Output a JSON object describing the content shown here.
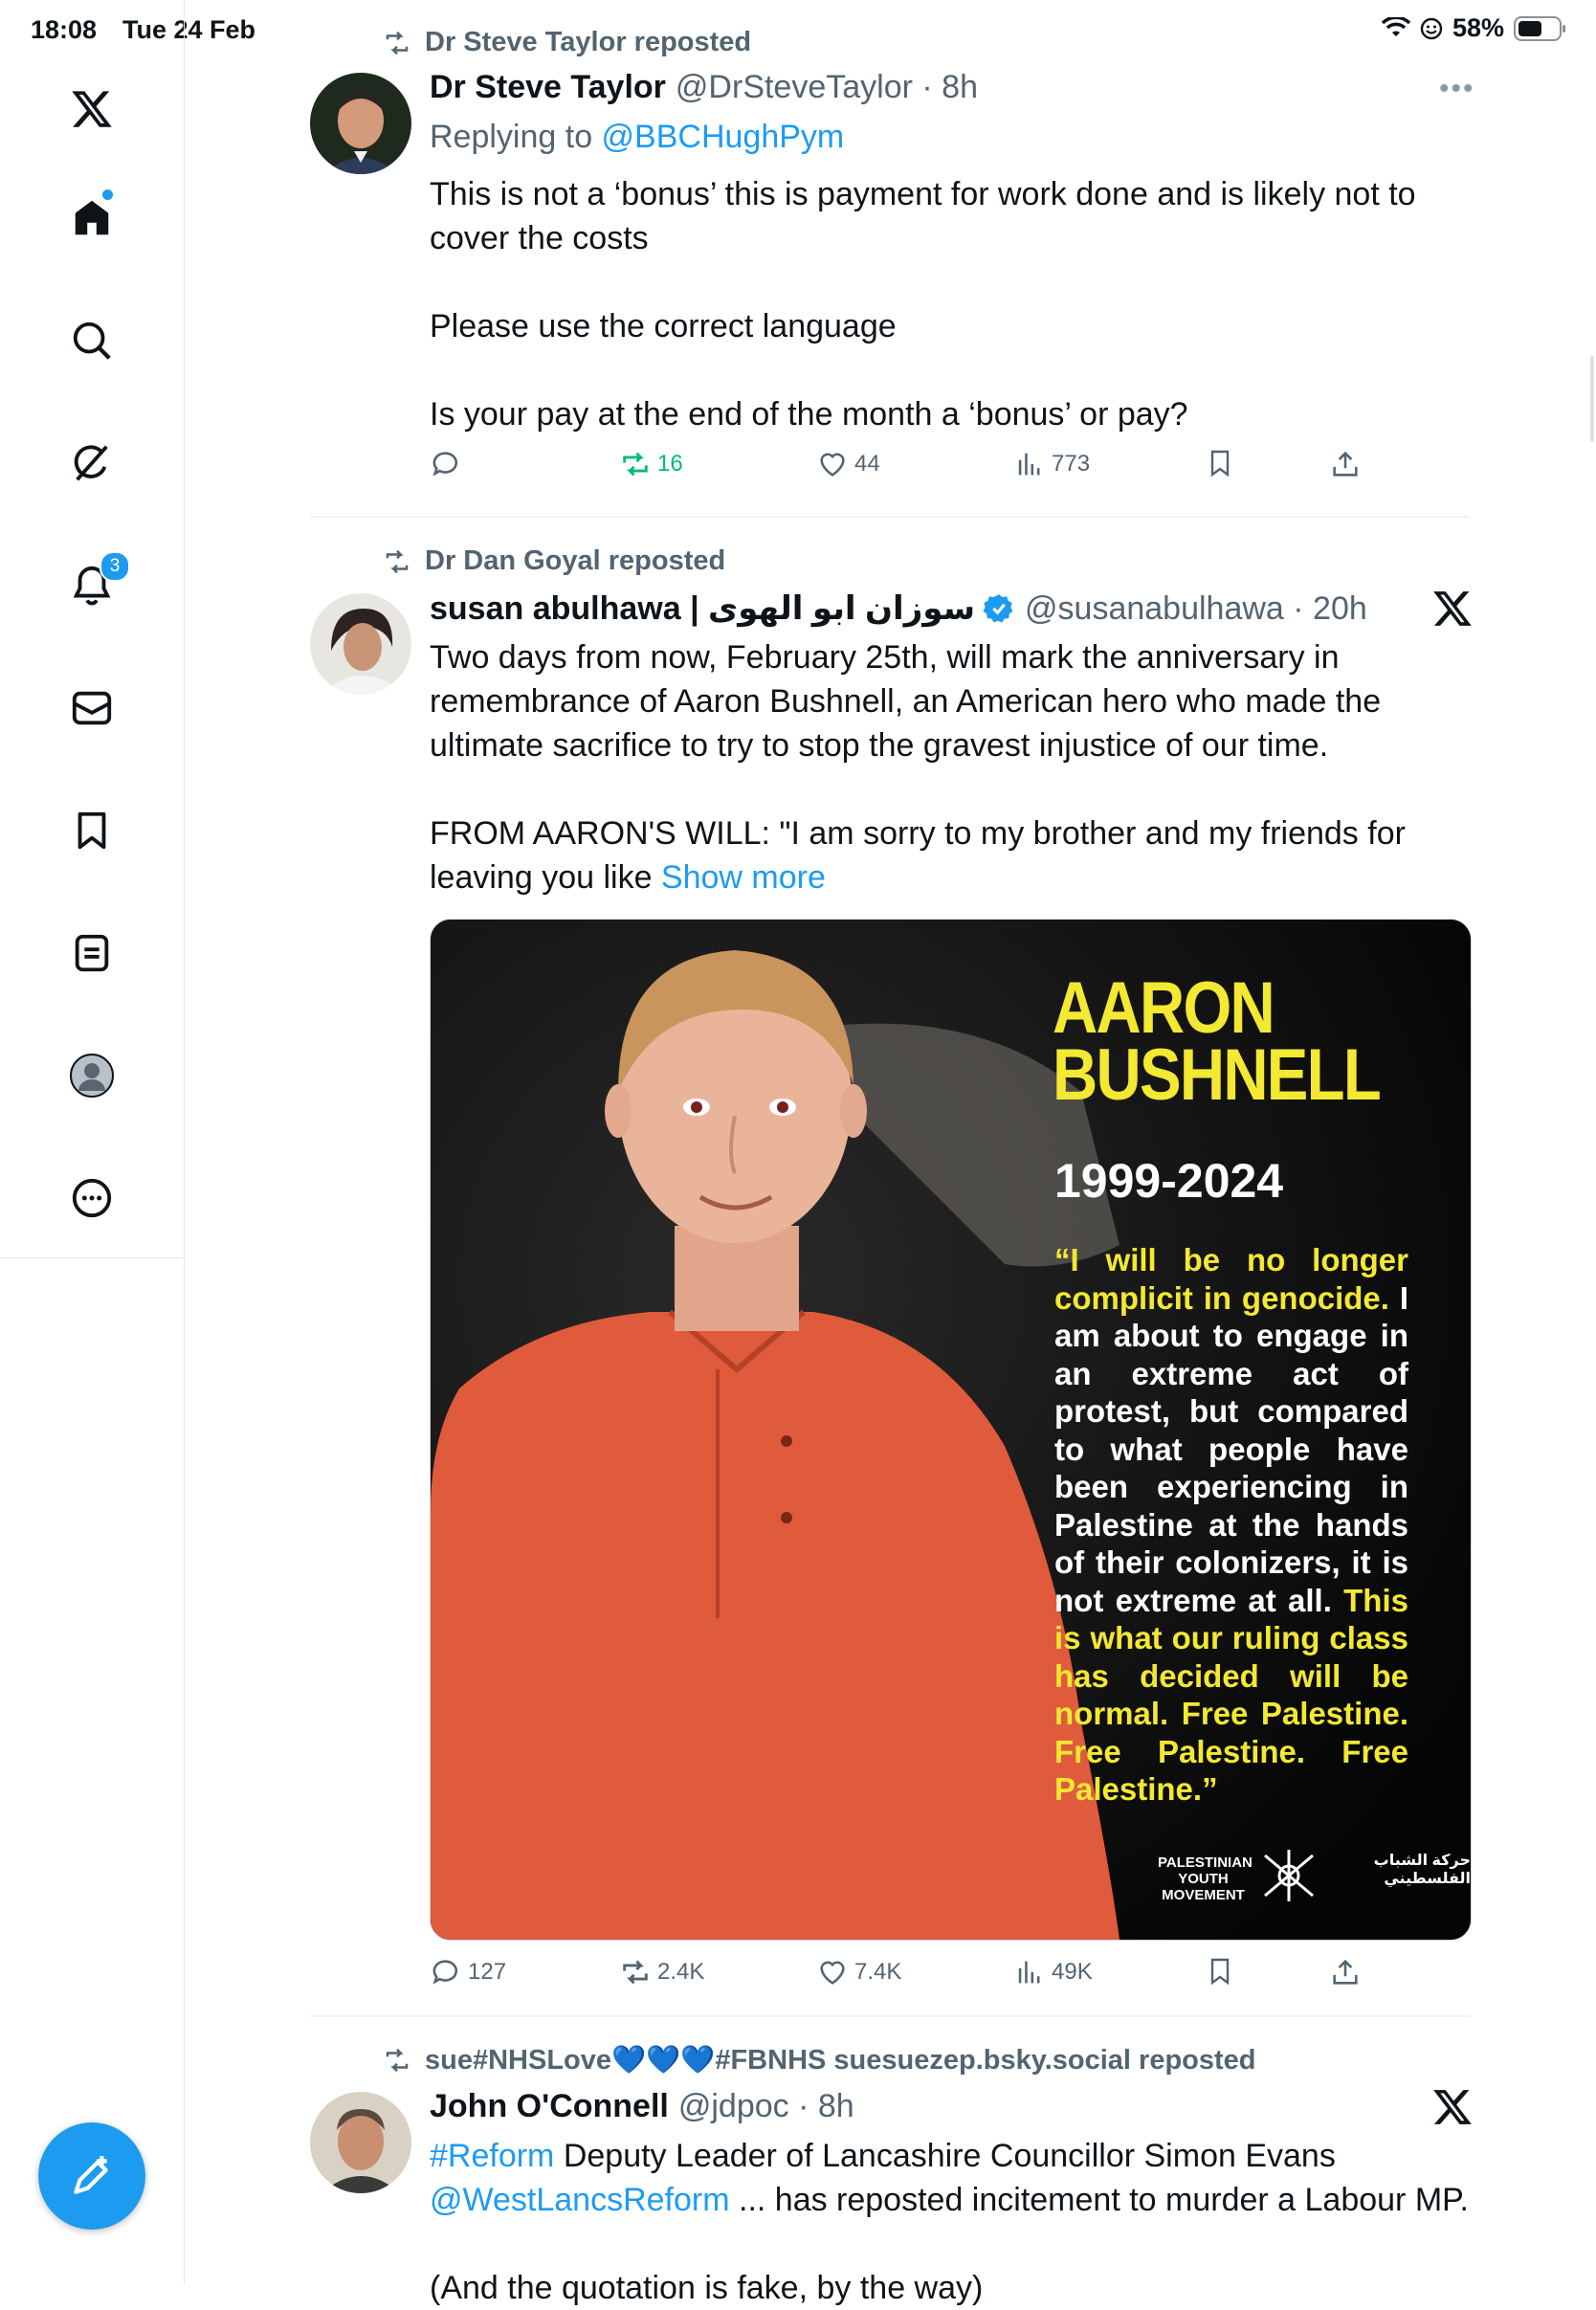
{
  "status_bar": {
    "time": "18:08",
    "date": "Tue 24 Feb",
    "battery": "58%"
  },
  "sidebar": {
    "notifications_badge": "3",
    "items": [
      "x-logo",
      "home",
      "search",
      "grok",
      "notifications",
      "messages",
      "bookmarks",
      "lists",
      "profile",
      "more"
    ]
  },
  "tweets": [
    {
      "repost_by": "Dr Steve Taylor reposted",
      "name": "Dr Steve Taylor",
      "handle": "@DrSteveTaylor · 8h",
      "replying_prefix": "Replying to ",
      "replying_to": "@BBCHughPym",
      "lines": [
        "This is not a ‘bonus’ this is payment for work done and is likely not to",
        "cover the costs",
        "",
        "Please use the correct language",
        "",
        "Is your pay at the end of the month a ‘bonus’ or pay?"
      ],
      "stats": {
        "replies": "",
        "reposts": "16",
        "likes": "44",
        "views": "773"
      }
    },
    {
      "repost_by": "Dr Dan Goyal reposted",
      "name": "susan abulhawa | سوزان ابو الهوى",
      "handle": "@susanabulhawa · 20h",
      "lines": [
        "Two days from now, February 25th, will mark the anniversary in",
        "remembrance of Aaron Bushnell, an American hero who made the",
        "ultimate sacrifice to try to stop the gravest injustice of our time.",
        "",
        "FROM AARON'S WILL: \"I am sorry to my brother and my friends for"
      ],
      "last_line": "leaving you like ",
      "show_more": "Show more",
      "image": {
        "title_line1": "AARON",
        "title_line2": "BUSHNELL",
        "years": "1999-2024",
        "quote_yellow": "“I will be no longer complicit in genocide.",
        "quote_white": " I am about to engage in an extreme act of protest, but compared to what people have been experiencing in Palestine at the hands of their colonizers, it is not extreme at all.",
        "quote_yellow2": " This is what our ruling class has decided will be normal. Free Palestine. Free Palestine. Free Palestine.”",
        "org_en": "PALESTINIAN YOUTH MOVEMENT",
        "org_ar": "حركة الشباب الفلسطيني"
      },
      "stats": {
        "replies": "127",
        "reposts": "2.4K",
        "likes": "7.4K",
        "views": "49K"
      }
    },
    {
      "repost_by": "sue#NHSLove💙💙💙#FBNHS suesuezep.bsky.social reposted",
      "name": "John O'Connell",
      "handle": "@jdpoc · 8h",
      "hashtag": "#Reform",
      "line1_rest": " Deputy Leader of Lancashire Councillor Simon Evans",
      "mention": "@WestLancsReform",
      "line2_rest": " ... has reposted incitement to murder a Labour MP.",
      "line3": "(And the quotation is fake, by the way)"
    }
  ],
  "colors": {
    "accent": "#1d9bf0",
    "repost_green": "#00ba7c",
    "muted": "#536471",
    "poster_yellow": "#f3e832"
  }
}
